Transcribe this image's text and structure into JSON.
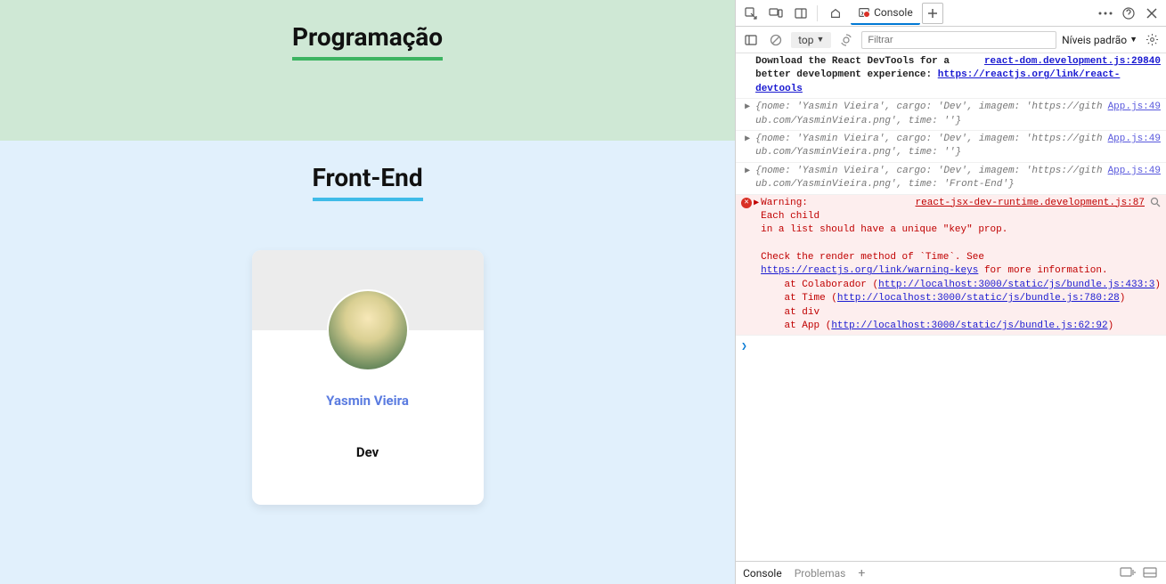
{
  "app": {
    "sections": [
      {
        "title": "Programação",
        "class": "green"
      },
      {
        "title": "Front-End",
        "class": "blue"
      }
    ],
    "card": {
      "name": "Yasmin Vieira",
      "role": "Dev"
    }
  },
  "devtools": {
    "tabs": {
      "console": "Console"
    },
    "toolbar": {
      "context": "top",
      "filter_placeholder": "Filtrar",
      "levels": "Níveis padrão"
    },
    "messages": {
      "react_src": "react-dom.development.js:29840",
      "react_text_1": "Download the React DevTools for a better development experience: ",
      "react_link": "https://reactjs.org/link/react-devtools",
      "app_src": "App.js:49",
      "obj1": "{nome: 'Yasmin Vieira', cargo: 'Dev', imagem: 'https://github.com/YasminVieira.png', time: ''}",
      "obj2": "{nome: 'Yasmin Vieira', cargo: 'Dev', imagem: 'https://github.com/YasminVieira.png', time: ''}",
      "obj3": "{nome: 'Yasmin Vieira', cargo: 'Dev', imagem: 'https://github.com/YasminVieira.png', time: 'Front-End'}",
      "err_src": "react-jsx-dev-runtime.development.js:87",
      "err_warning": "Warning:",
      "err_l1": "Each child",
      "err_l2": "in a list should have a unique \"key\" prop.",
      "err_l3": "Check the render method of `Time`. See ",
      "err_keys_link": "https://reactjs.org/link/warning-keys",
      "err_l3b": " for more information.",
      "err_at1a": "    at Colaborador (",
      "err_at1_link": "http://localhost:3000/static/js/bundle.js:433:3",
      "err_close": ")",
      "err_at2a": "    at Time (",
      "err_at2_link": "http://localhost:3000/static/js/bundle.js:780:28",
      "err_at3": "    at div",
      "err_at4a": "    at App (",
      "err_at4_link": "http://localhost:3000/static/js/bundle.js:62:92"
    },
    "drawer": {
      "console": "Console",
      "problems": "Problemas"
    },
    "prompt": "❯"
  }
}
